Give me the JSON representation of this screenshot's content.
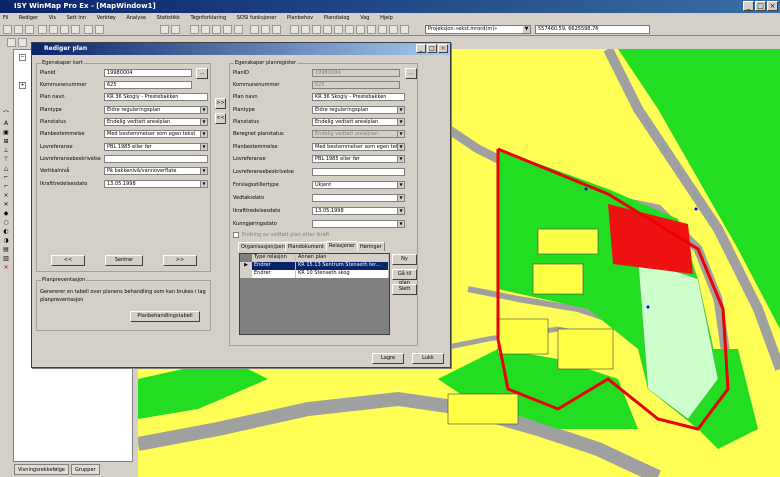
{
  "app": {
    "title": "ISY WinMap Pro Ex - [MapWindow1]"
  },
  "menu": [
    "Fil",
    "Rediger",
    "Vis",
    "Sett inn",
    "Verktøy",
    "Analyse",
    "Statistikk",
    "Tegnforklaring",
    "SOSI funksjoner",
    "Planbehov",
    "Plandialog",
    "Vag",
    "Hjelp",
    "Hjelp"
  ],
  "toolbar": {
    "projection": "Projeksjon:«ekst.mrord(m)»",
    "coords": "557460.59, 6625598.76"
  },
  "statusbar": {
    "tab1": "Visningsrekkefølge",
    "tab2": "Grupper"
  },
  "dialog": {
    "title": "Rediger plan",
    "left_group": "Egenskaper kart",
    "left_fields": [
      {
        "label": "PlanId",
        "value": "19980004"
      },
      {
        "label": "Kommunenummer",
        "value": "625"
      },
      {
        "label": "Plan navn",
        "value": "KR 36 Skogly - Prestebakken"
      },
      {
        "label": "Plantype",
        "value": "Eldre reguleringsplan"
      },
      {
        "label": "Planstatus",
        "value": "Endelig vedtatt arealplan"
      },
      {
        "label": "Planbestemmelse",
        "value": "Med bestemmelser som egen tekst"
      },
      {
        "label": "Lovreferanse",
        "value": "PBL 1985 eller før"
      },
      {
        "label": "Lovreferansebeskrivelse",
        "value": ""
      },
      {
        "label": "Vertikalnivå",
        "value": "På bakkenivå/vannoverflate"
      },
      {
        "label": "Ikrafttredelsesdato",
        "value": "13.05.1998"
      }
    ],
    "nav": {
      "prev": "<<",
      "center": "Sentrer",
      "next": ">>"
    },
    "arrows": {
      "right": ">>",
      "left": "<<"
    },
    "planprev_group": "Planpreventasjon",
    "planprev_text": "Genererer en tabell over planens behandling som kan brukes i lag planpreventasjon",
    "planprev_button": "Planbehandlingstabell",
    "right_group": "Egenskaper planregister",
    "right_fields": [
      {
        "label": "PlanID",
        "value": "19980004"
      },
      {
        "label": "Kommunenummer",
        "value": "625"
      },
      {
        "label": "Plan navn",
        "value": "KR 36 Skogly - Prestebakken"
      },
      {
        "label": "Plantype",
        "value": "Eldre reguleringsplan"
      },
      {
        "label": "Planstatus",
        "value": "Endelig vedtatt arealplan"
      },
      {
        "label": "Beregnet planstatus",
        "value": "Endelig vedtatt arealplan"
      },
      {
        "label": "Planbestemmelse",
        "value": "Med bestemmelser som egen tekst"
      },
      {
        "label": "Lovreferanse",
        "value": "PBL 1985 eller før"
      },
      {
        "label": "Lovreferansebeskrivelse",
        "value": ""
      },
      {
        "label": "Forslagsstillertype",
        "value": "Ukjent"
      },
      {
        "label": "Vedtaksdato",
        "value": ""
      },
      {
        "label": "Ikrafttredelsesdato",
        "value": "13.05.1998"
      },
      {
        "label": "Kunngjøringsdato",
        "value": ""
      }
    ],
    "checkbox": "Endring av vedtatt plan etter ikraft",
    "tabs": [
      "Organisasjon/person",
      "Plandokument",
      "Relasjoner",
      "Høringer"
    ],
    "grid": {
      "headers": [
        "Type relasjon",
        "Annen plan"
      ],
      "rows": [
        [
          "Endrer",
          "KR 15.13 Sentrum Stenseth ter..."
        ],
        [
          "Endrer",
          "KR 10 Stenseth skog"
        ]
      ]
    },
    "grid_buttons": [
      "Ny",
      "Gå til plan",
      "Slett"
    ],
    "footer": {
      "save": "Lagre",
      "close": "Lukk"
    }
  }
}
